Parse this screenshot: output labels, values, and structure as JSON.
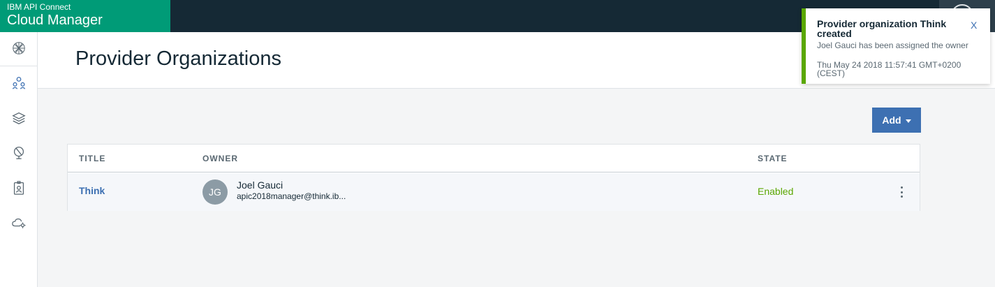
{
  "app": {
    "vendor": "IBM API Connect",
    "product": "Cloud Manager"
  },
  "nav": {
    "items": [
      {
        "icon": "globe-network-icon",
        "label": "Home"
      },
      {
        "icon": "provider-organizations-icon",
        "label": "Provider Organizations"
      },
      {
        "icon": "layers-icon",
        "label": "Resources"
      },
      {
        "icon": "topology-globe-icon",
        "label": "Topology"
      },
      {
        "icon": "member-badge-icon",
        "label": "Members"
      },
      {
        "icon": "cloud-settings-icon",
        "label": "Settings"
      }
    ]
  },
  "page": {
    "title": "Provider Organizations",
    "add_button": "Add"
  },
  "table": {
    "columns": [
      "TITLE",
      "OWNER",
      "STATE"
    ],
    "rows": [
      {
        "title": "Think",
        "owner_initials": "JG",
        "owner_name": "Joel Gauci",
        "owner_email": "apic2018manager@think.ib...",
        "state": "Enabled"
      }
    ]
  },
  "notification": {
    "title": "Provider organization Think created",
    "message": "Joel Gauci has been assigned the owner",
    "timestamp": "Thu May 24 2018 11:57:41 GMT+0200 (CEST)",
    "close": "X"
  },
  "colors": {
    "brand": "#009b77",
    "topbar": "#152935",
    "primary": "#3d70b2",
    "success": "#5aa700"
  }
}
